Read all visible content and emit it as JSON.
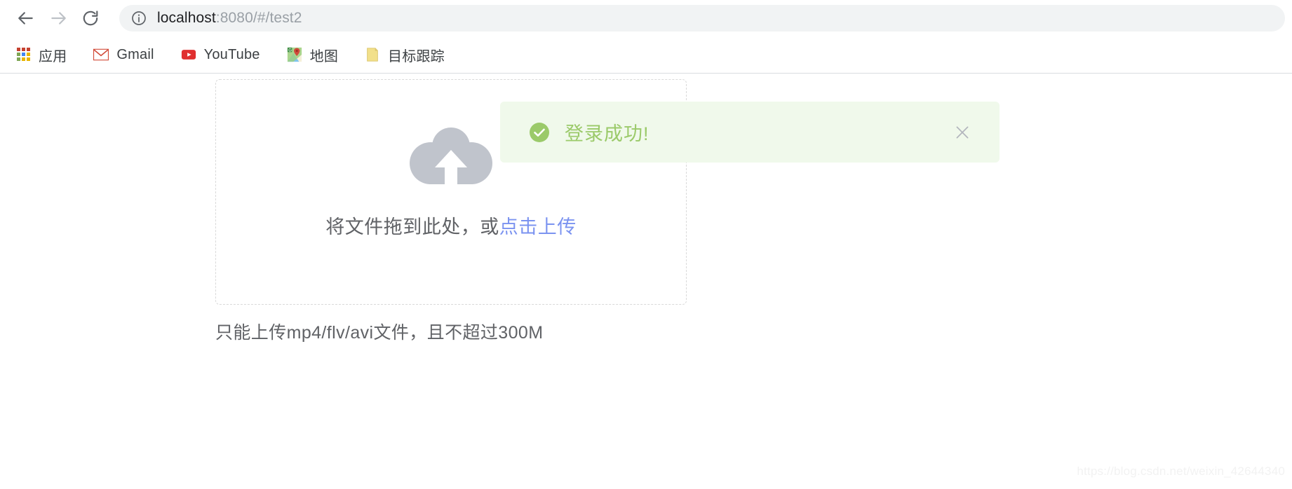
{
  "browser": {
    "back_label": "Back",
    "forward_label": "Forward",
    "reload_label": "Reload",
    "icons": {
      "back": "arrow-left-icon",
      "forward": "arrow-right-icon",
      "reload": "reload-icon",
      "site_info": "info-circle-icon"
    },
    "omnibox": {
      "url_host": "localhost",
      "url_path": ":8080/#/test2",
      "full_url": "localhost:8080/#/test2"
    },
    "bookmarks": [
      {
        "label": "应用",
        "icon": "apps-grid-icon"
      },
      {
        "label": "Gmail",
        "icon": "gmail-icon"
      },
      {
        "label": "YouTube",
        "icon": "youtube-icon"
      },
      {
        "label": "地图",
        "icon": "google-maps-icon"
      },
      {
        "label": "目标跟踪",
        "icon": "note-page-icon"
      }
    ]
  },
  "page": {
    "upload": {
      "dropzone_text_prefix": "将文件拖到此处，或",
      "dropzone_link_text": "点击上传",
      "tip_text": "只能上传mp4/flv/avi文件，且不超过300M",
      "cloud_icon": "cloud-upload-icon"
    },
    "alert": {
      "title": "登录成功!",
      "type": "success",
      "icon": "circle-check-icon",
      "close_icon": "close-icon"
    },
    "watermark": "https://blog.csdn.net/weixin_42644340"
  },
  "colors": {
    "alert_background": "#f0f9eb",
    "alert_text": "#9bca6a",
    "alert_icon": "#9bca6a",
    "upload_link": "#7b93f0",
    "cloud_icon": "#c0c4cc",
    "dropzone_border": "#d9d9d9",
    "body_text": "#606266",
    "url_host_text": "#202124",
    "url_path_text": "#9aa0a6",
    "omnibox_background": "#f1f3f4",
    "watermark_text": "#f2f2f2"
  }
}
